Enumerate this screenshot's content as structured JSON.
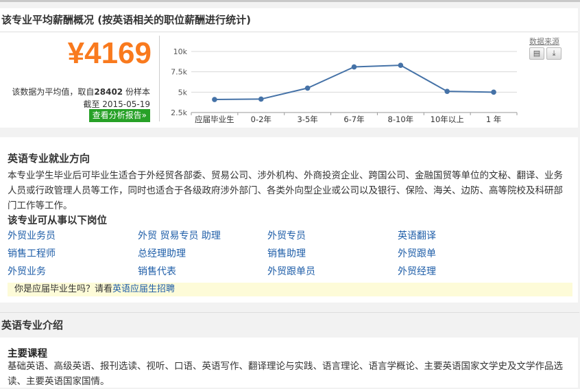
{
  "salary": {
    "header": "该专业平均薪酬概况 (按英语相关的职位薪酬进行统计)",
    "amount": "¥4169",
    "note_prefix": "该数据为平均值，取自",
    "sample_count": "28402",
    "note_suffix": "份样本",
    "date_line": "截至 2015-05-19",
    "report_button": "查看分析报告»",
    "source_link": "数据来源",
    "tools": [
      {
        "icon": "print-icon",
        "glyph": "▤"
      },
      {
        "icon": "download-icon",
        "glyph": "⤓"
      }
    ]
  },
  "chart_data": {
    "type": "line",
    "categories": [
      "应届毕业生",
      "0-2年",
      "3-5年",
      "6-7年",
      "8-10年",
      "10年以上",
      "1 年"
    ],
    "values": [
      4100,
      4150,
      5500,
      8100,
      8300,
      5100,
      5000
    ],
    "y_ticks": [
      "2.5k",
      "5k",
      "7.5k",
      "10k"
    ],
    "ylim": [
      2500,
      10000
    ],
    "grid": true,
    "line_color": "#4572a7"
  },
  "career": {
    "title": "英语专业就业方向",
    "description": "本专业学生毕业后可毕业生适合于外经贸各部委、贸易公司、涉外机构、外商投资企业、跨国公司、金融国贸等单位的文秘、翻译、业务人员或行政管理人员等工作，同时也适合于各级政府涉外部门、各类外向型企业或公司以及银行、保险、海关、边防、高等院校及科研部门工作等工作。",
    "jobs_title": "该专业可从事以下岗位",
    "jobs": [
      [
        "外贸业务员",
        "外贸 贸易专员 助理",
        "外贸专员",
        "英语翻译"
      ],
      [
        "销售工程师",
        "总经理助理",
        "销售助理",
        "外贸跟单"
      ],
      [
        "外贸业务",
        "销售代表",
        "外贸跟单员",
        "外贸经理"
      ]
    ],
    "notice_text": "你是应届毕业生吗？请看",
    "notice_link": "英语应届生招聘"
  },
  "intro": {
    "header": "英语专业介绍",
    "course_title": "主要课程",
    "course_desc": "基础英语、高级英语、报刊选读、视听、口语、英语写作、翻译理论与实践、语言理论、语言学概论、主要英语国家文学史及文学作品选读、主要英语国家国情。"
  }
}
